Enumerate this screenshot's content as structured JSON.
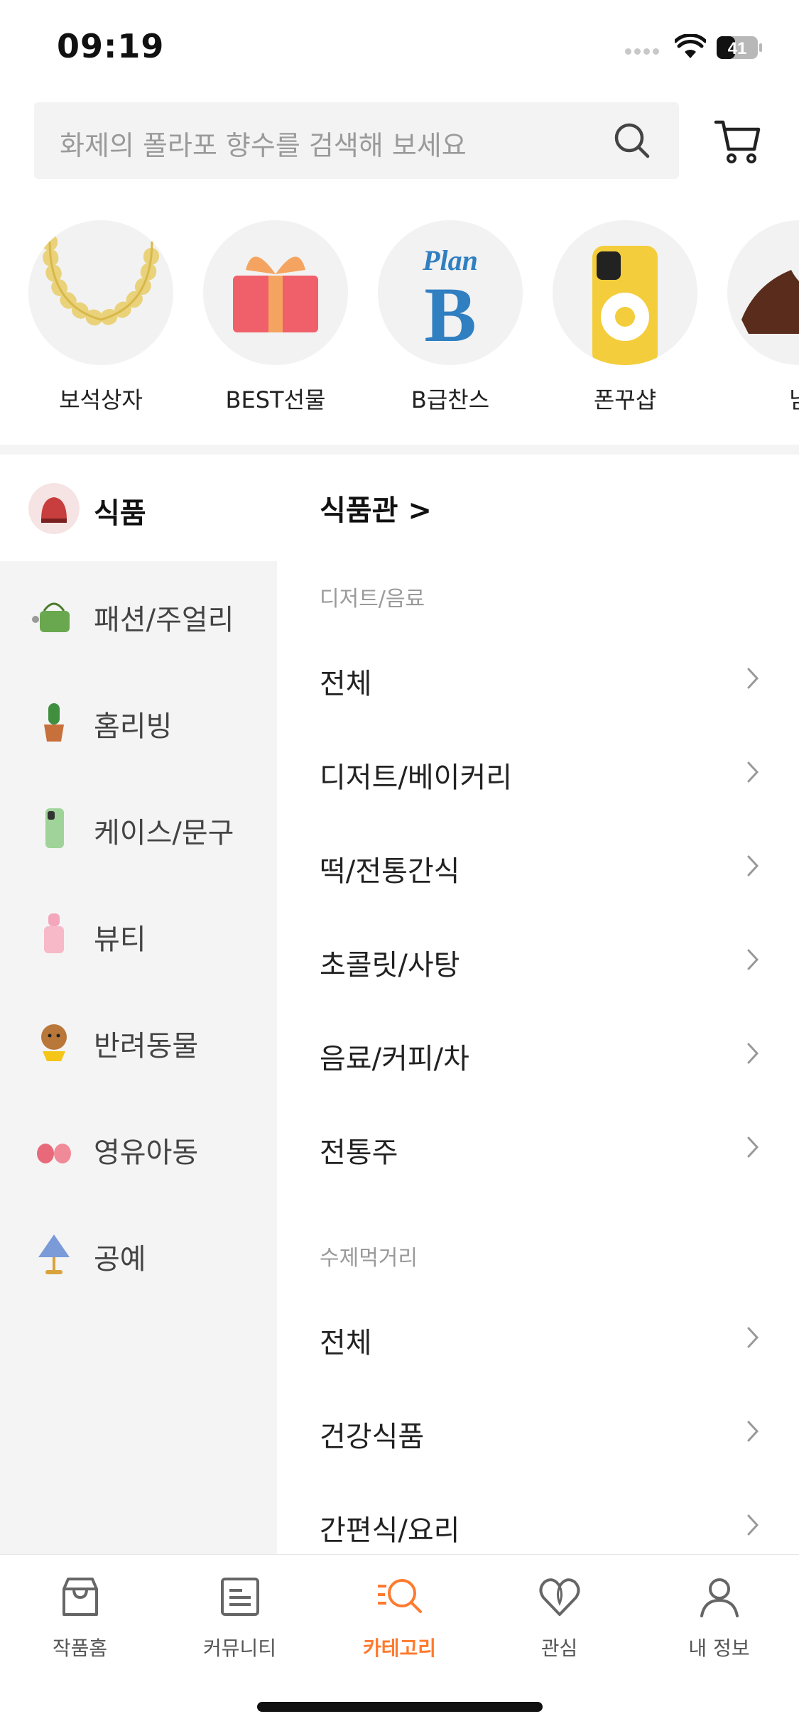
{
  "status_bar": {
    "time": "09:19",
    "battery": "41"
  },
  "search": {
    "placeholder": "화제의 폴라포 향수를 검색해 보세요"
  },
  "icons": {
    "search": "search-icon",
    "cart": "cart-icon",
    "chevron": "chevron-right-icon"
  },
  "colors": {
    "accent": "#ff7a2e",
    "background_gray": "#f4f4f4",
    "text": "#222222"
  },
  "quick_categories": [
    {
      "label": "보석상자",
      "icon": "necklace-icon"
    },
    {
      "label": "BEST선물",
      "icon": "gift-box-icon"
    },
    {
      "label": "B급찬스",
      "icon": "plan-b-logo"
    },
    {
      "label": "폰꾸샵",
      "icon": "phone-case-icon"
    },
    {
      "label": "남",
      "icon": "shoe-icon"
    }
  ],
  "sidebar": {
    "items": [
      {
        "label": "식품",
        "active": true
      },
      {
        "label": "패션/주얼리"
      },
      {
        "label": "홈리빙"
      },
      {
        "label": "케이스/문구"
      },
      {
        "label": "뷰티"
      },
      {
        "label": "반려동물"
      },
      {
        "label": "영유아동"
      },
      {
        "label": "공예"
      }
    ]
  },
  "main": {
    "header": "식품관 >",
    "sections": [
      {
        "title": "디저트/음료",
        "items": [
          "전체",
          "디저트/베이커리",
          "떡/전통간식",
          "초콜릿/사탕",
          "음료/커피/차",
          "전통주"
        ]
      },
      {
        "title": "수제먹거리",
        "items": [
          "전체",
          "건강식품",
          "간편식/요리"
        ]
      }
    ]
  },
  "tabbar": {
    "tabs": [
      {
        "label": "작품홈"
      },
      {
        "label": "커뮤니티"
      },
      {
        "label": "카테고리",
        "active": true
      },
      {
        "label": "관심"
      },
      {
        "label": "내 정보"
      }
    ]
  }
}
